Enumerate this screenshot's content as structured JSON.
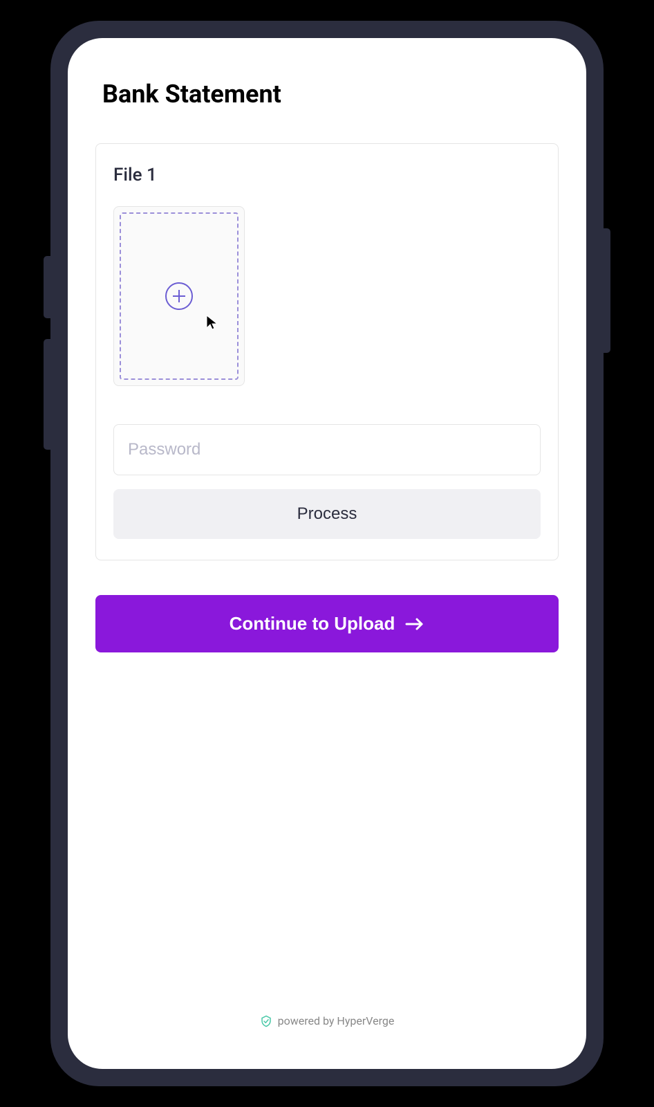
{
  "header": {
    "title": "Bank Statement"
  },
  "upload": {
    "file_label": "File 1",
    "password_placeholder": "Password",
    "process_label": "Process"
  },
  "actions": {
    "continue_label": "Continue to Upload"
  },
  "footer": {
    "text": "powered by HyperVerge"
  },
  "colors": {
    "primary": "#8a18db",
    "accent": "#6b5dd3",
    "frame": "#2b2d3e"
  }
}
